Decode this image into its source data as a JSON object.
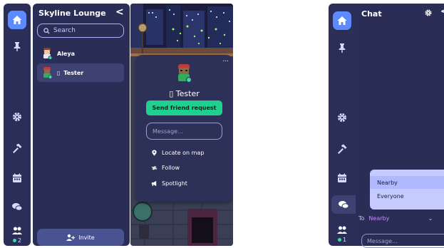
{
  "left": {
    "rail": {
      "icons": [
        "home-icon",
        "pin-icon",
        "gear-icon",
        "hammer-icon",
        "calendar-icon",
        "chat-icon",
        "people-icon"
      ],
      "online_count": "2"
    },
    "panel": {
      "title": "Skyline Lounge",
      "back_glyph": "<",
      "search_placeholder": "Search",
      "users": [
        {
          "name": "Aleya"
        },
        {
          "name": "Tester"
        }
      ],
      "invite_label": "Invite"
    },
    "profile": {
      "more_glyph": "...",
      "name": "Tester",
      "friend_request_label": "Send friend request",
      "message_placeholder": "Message...",
      "actions": [
        {
          "label": "Locate on map",
          "icon": "location-icon"
        },
        {
          "label": "Follow",
          "icon": "follow-icon"
        },
        {
          "label": "Spotlight",
          "icon": "megaphone-icon"
        }
      ]
    }
  },
  "right": {
    "rail": {
      "icons": [
        "home-icon",
        "pin-icon",
        "gear-icon",
        "hammer-icon",
        "calendar-icon",
        "chat-icon",
        "people-icon"
      ],
      "online_count": "1"
    },
    "chat": {
      "title": "Chat",
      "back_glyph": "<",
      "dropdown_options": [
        "Nearby",
        "Everyone"
      ],
      "to_label": "To",
      "to_value": "Nearby",
      "message_placeholder": "Message..."
    }
  },
  "colors": {
    "rail": "#2b2f57",
    "panel": "#2a2d55",
    "accent_blue": "#5b8bff",
    "accent_green": "#1fd18e",
    "dropdown": "#c6cbff",
    "to_value": "#c48bff"
  }
}
